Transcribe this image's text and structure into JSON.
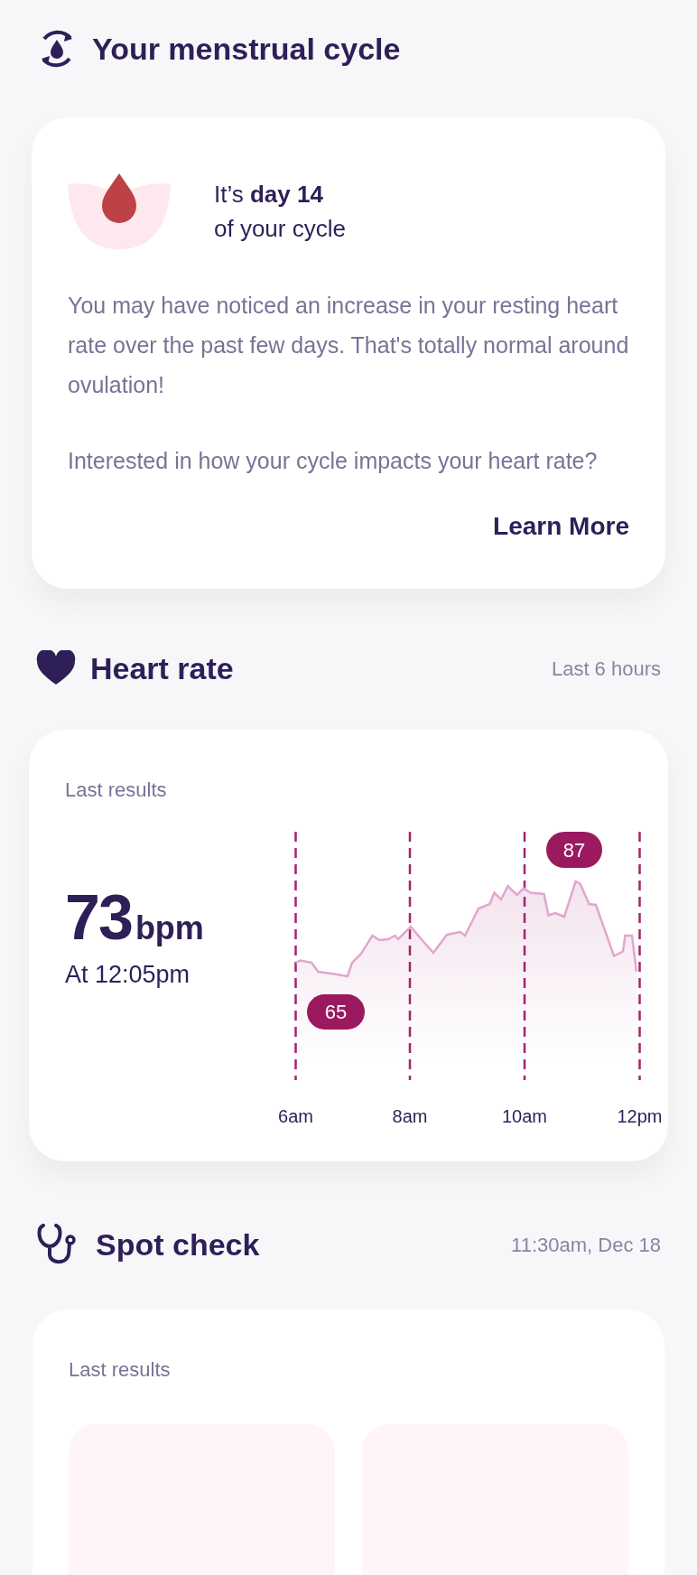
{
  "cycle": {
    "title": "Your menstrual cycle",
    "day_text": "It’s **day 14**",
    "day_subtext": "of your cycle",
    "paragraphs": [
      "You may have noticed an increase in your resting heart rate over the past few days. That's totally normal around ovulation!",
      "Interested in how your cycle impacts your heart rate?"
    ],
    "link": "Learn More"
  },
  "heart_rate": {
    "title": "Heart rate",
    "period": "Last 6 hours",
    "label": "Last results",
    "value": "73",
    "unit": "bpm",
    "time": "At 12:05pm",
    "x_labels": [
      "6am",
      "8am",
      "10am",
      "12pm"
    ],
    "min_label": "65",
    "max_label": "87"
  },
  "spot_check": {
    "title": "Spot check",
    "timestamp": "11:30am, Dec 18",
    "label": "Last results"
  }
}
